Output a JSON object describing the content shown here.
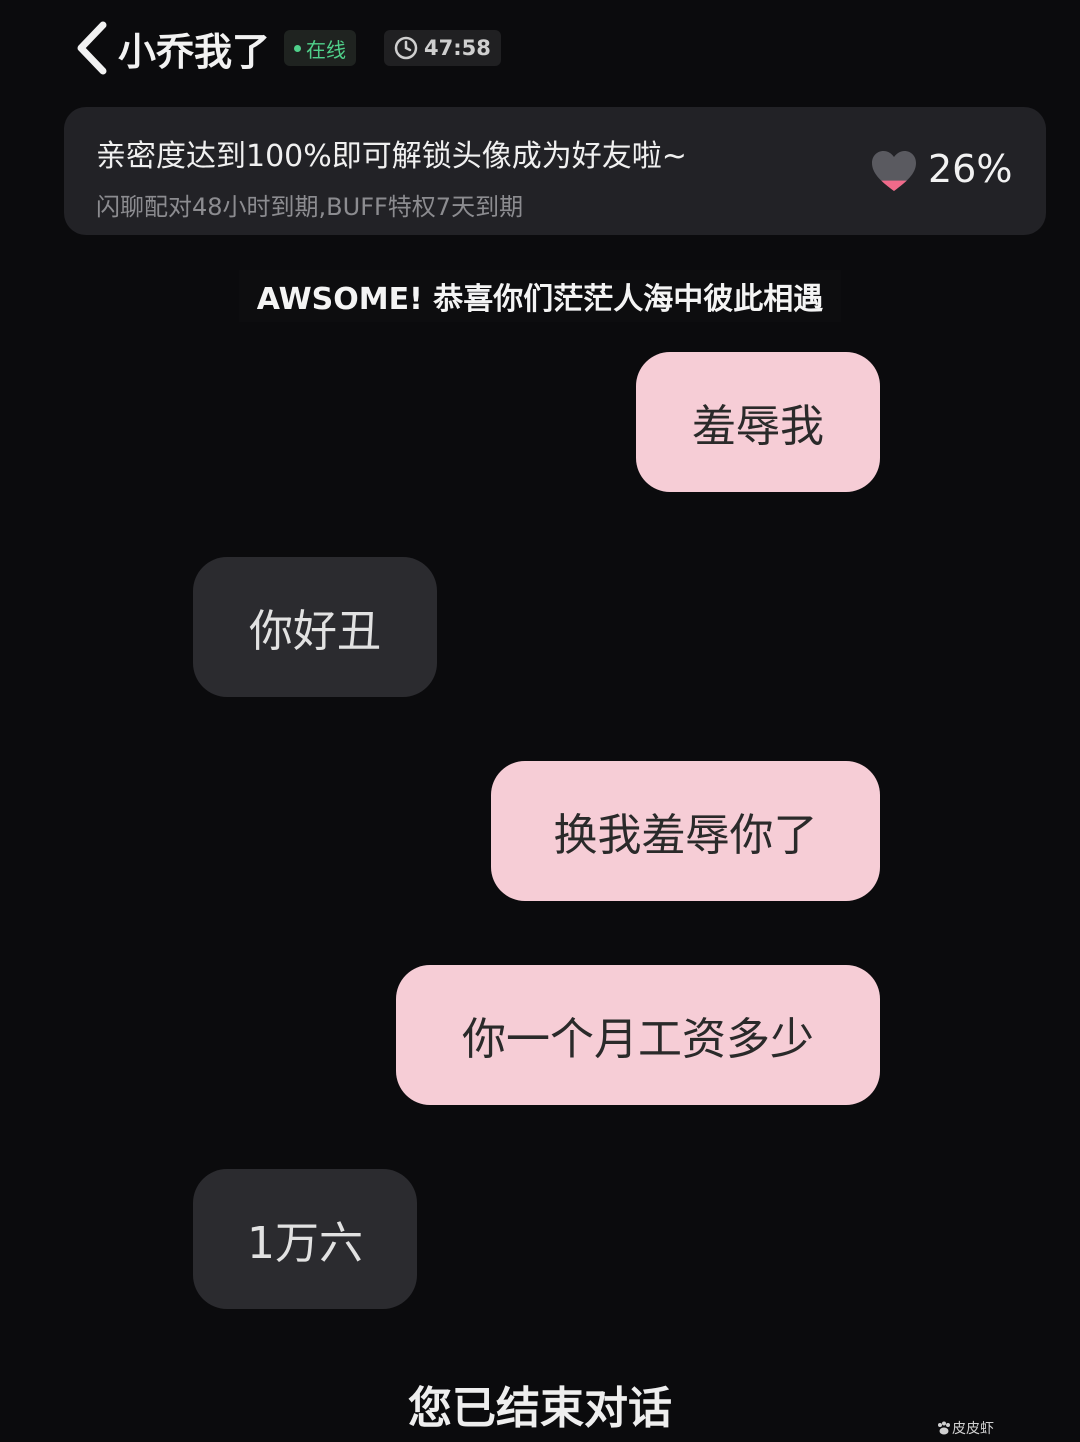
{
  "header": {
    "title": "小乔我了",
    "online_label": "在线",
    "timer": "47:58"
  },
  "intimacy": {
    "title": "亲密度达到100%即可解锁头像成为好友啦~",
    "subtitle": "闪聊配对48小时到期,BUFF特权7天到期",
    "percent": "26%",
    "progress": 0.26
  },
  "system_notice": "AWSOME! 恭喜你们茫茫人海中彼此相遇",
  "messages": [
    {
      "from": "me",
      "text": "羞辱我"
    },
    {
      "from": "other",
      "text": "你好丑"
    },
    {
      "from": "me",
      "text": "换我羞辱你了"
    },
    {
      "from": "me",
      "text": "你一个月工资多少"
    },
    {
      "from": "other",
      "text": "1万六"
    }
  ],
  "end_notice": "您已结束对话",
  "watermark": "皮皮虾",
  "colors": {
    "sent_bubble": "#f6cdd6",
    "received_bubble": "#2b2b2f",
    "online_green": "#4fd08a",
    "heart_pink": "#f06a8a"
  }
}
